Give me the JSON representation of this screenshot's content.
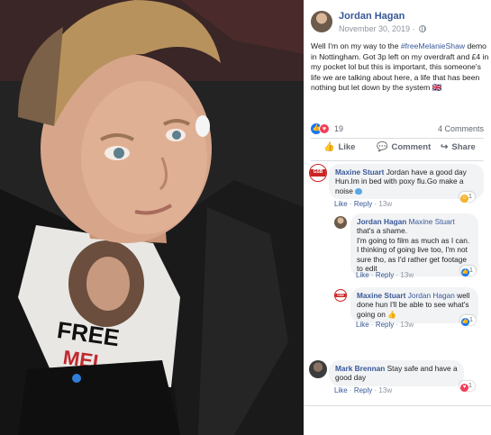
{
  "post": {
    "author": "Jordan Hagan",
    "date": "November 30, 2019",
    "date_sep": "·",
    "text_before": "Well I'm on my way to the ",
    "hashtag": "#freeMelanieShaw",
    "text_after": " demo in Nottingham. Got 3p left on my overdraft and £4 in my pocket lol but this is important, this someone's life we are talking about here, a life that has been nothing but let down by the system",
    "text_emoji": "🇬🇧",
    "reaction_count": "19",
    "comment_count": "4 Comments"
  },
  "actions": {
    "like": "Like",
    "comment": "Comment",
    "share": "Share"
  },
  "icons": {
    "like": "👍",
    "comment": "💬",
    "share": "↪"
  },
  "colors": {
    "link": "#385898",
    "like_blue": "#1877f2",
    "love_red": "#f33e58"
  },
  "comments": [
    {
      "author": "Maxine Stuart",
      "text": " Jordan have a good day Hun.Im in bed with poxy flu.Go make a noise",
      "like": "Like",
      "reply": "Reply",
      "time": "13w",
      "reaction_count": "1",
      "sep": "·"
    },
    {
      "author": "Jordan Hagan",
      "tag": "Maxine Stuart",
      "text": " that's a shame.\nI'm going to film as much as I can. I thinking of going live too, I'm not sure tho, as I'd rather get footage to edit",
      "like": "Like",
      "reply": "Reply",
      "time": "13w",
      "reaction_count": "1",
      "sep": "·"
    },
    {
      "author": "Maxine Stuart",
      "tag": "Jordan Hagan",
      "text": " well done hun I'll be able to see what's going on",
      "like": "Like",
      "reply": "Reply",
      "time": "13w",
      "reaction_count": "1",
      "sep": "·"
    },
    {
      "author": "Mark Brennan",
      "text": " Stay safe and have a good day",
      "like": "Like",
      "reply": "Reply",
      "time": "13w",
      "reaction_count": "1",
      "sep": "·"
    }
  ],
  "avatar_gsb": "GSB",
  "shirt_text": "FREE\nMEL"
}
